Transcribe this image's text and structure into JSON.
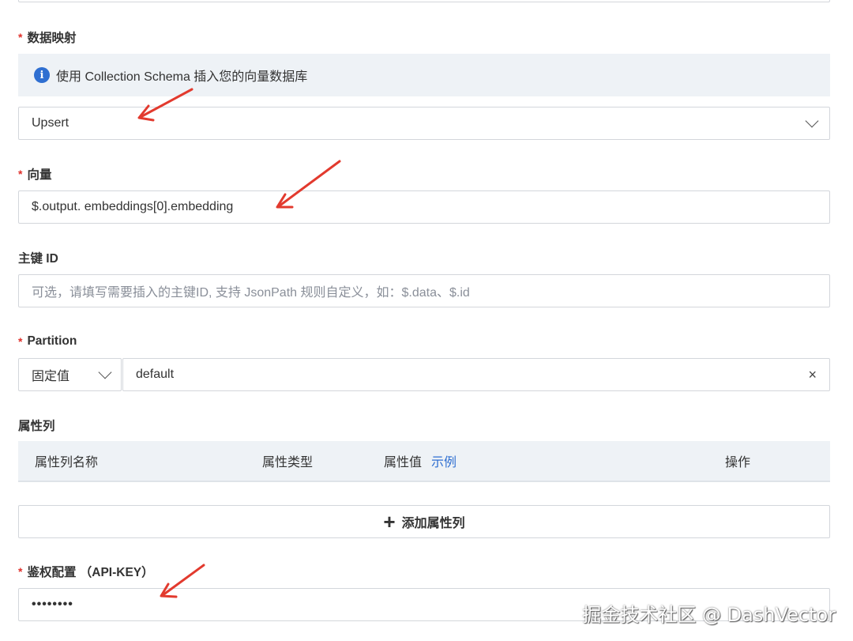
{
  "colors": {
    "required": "#e0302a",
    "accent": "#2f6fd1",
    "info_bg": "#eef2f6",
    "arrow": "#e23a2e"
  },
  "data_mapping": {
    "required_mark": "*",
    "label": "数据映射",
    "info_icon": "info-icon",
    "info_text": "使用 Collection Schema 插入您的向量数据库",
    "mode_value": "Upsert"
  },
  "vector": {
    "required_mark": "*",
    "label": "向量",
    "value": "$.output. embeddings[0].embedding"
  },
  "primary_key": {
    "label": "主键 ID",
    "placeholder": "可选，请填写需要插入的主键ID, 支持 JsonPath 规则自定义，如：$.data、$.id"
  },
  "partition": {
    "required_mark": "*",
    "label": "Partition",
    "type_value": "固定值",
    "value": "default",
    "clear_icon": "×"
  },
  "attributes": {
    "label": "属性列",
    "columns": {
      "name": "属性列名称",
      "type": "属性类型",
      "value": "属性值",
      "example_link": "示例",
      "action": "操作"
    },
    "add_button_icon": "+",
    "add_button_label": "添加属性列"
  },
  "auth": {
    "required_mark": "*",
    "label": "鉴权配置 （API-KEY）",
    "value": "••••••••"
  },
  "watermark": "掘金技术社区 @ DashVector"
}
